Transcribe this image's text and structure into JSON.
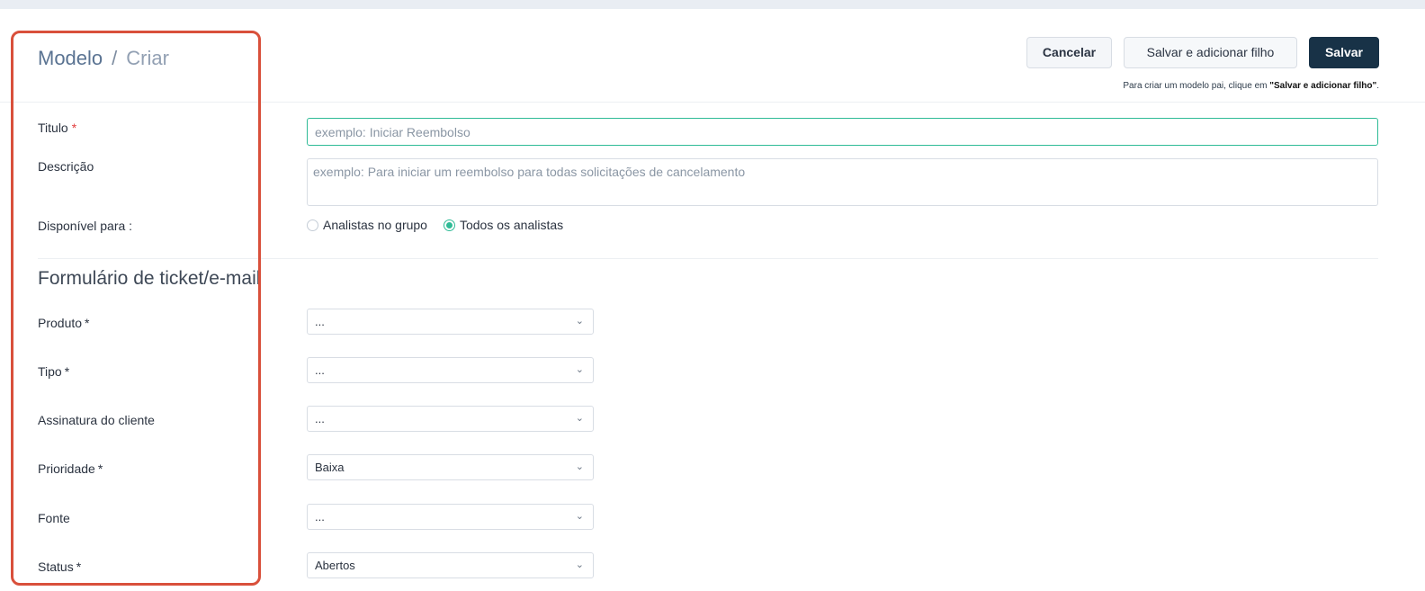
{
  "breadcrumb": {
    "parent": "Modelo",
    "separator": "/",
    "current": "Criar"
  },
  "actions": {
    "cancel": "Cancelar",
    "save_add_child": "Salvar e adicionar filho",
    "save": "Salvar",
    "hint_prefix": "Para criar um modelo pai, clique em ",
    "hint_bold": "\"Salvar e adicionar filho\"",
    "hint_suffix": "."
  },
  "form": {
    "title": {
      "label": "Titulo",
      "required_mark": "*",
      "placeholder": "exemplo: Iniciar Reembolso",
      "value": ""
    },
    "description": {
      "label": "Descrição",
      "placeholder": "exemplo: Para iniciar um reembolso para todas solicitações de cancelamento",
      "value": ""
    },
    "availability": {
      "label": "Disponível para :",
      "options": [
        {
          "label": "Analistas no grupo",
          "selected": false
        },
        {
          "label": "Todos os analistas",
          "selected": true
        }
      ]
    }
  },
  "section": {
    "title": "Formulário de ticket/e-mail"
  },
  "fields": {
    "produto": {
      "label": "Produto",
      "required_mark": "*",
      "value": "..."
    },
    "tipo": {
      "label": "Tipo",
      "required_mark": "*",
      "value": "..."
    },
    "assinatura": {
      "label": "Assinatura do cliente",
      "value": "..."
    },
    "prioridade": {
      "label": "Prioridade",
      "required_mark": "*",
      "value": "Baixa"
    },
    "fonte": {
      "label": "Fonte",
      "value": "..."
    },
    "status": {
      "label": "Status",
      "required_mark": "*",
      "value": "Abertos"
    }
  },
  "icons": {
    "dropdown": "chevron-down-icon",
    "chevron_glyph": "❯"
  },
  "colors": {
    "primary_button": "#183247",
    "focus_green": "#2fbb96",
    "required_red": "#e24040",
    "highlight_box": "#d9503b"
  }
}
